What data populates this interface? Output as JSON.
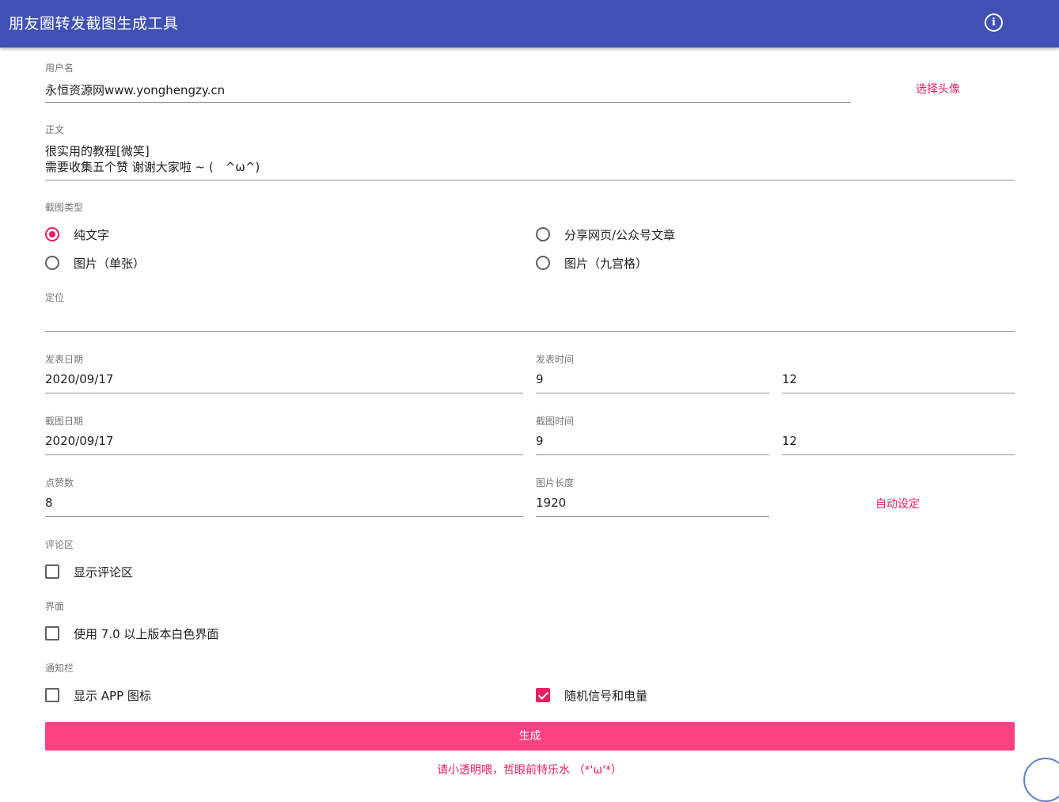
{
  "appbar": {
    "title": "朋友圈转发截图生成工具",
    "info_icon": "info-icon"
  },
  "username": {
    "label": "用户名",
    "value": "永恒资源网www.yonghengzy.cn",
    "choose_avatar": "选择头像"
  },
  "body": {
    "label": "正文",
    "line1": "很实用的教程[微笑]",
    "line2": "需要收集五个赞 谢谢大家啦 ~ (　^ω^)"
  },
  "screenshot_type": {
    "label": "截图类型",
    "options": [
      {
        "label": "纯文字",
        "selected": true
      },
      {
        "label": "分享网页/公众号文章",
        "selected": false
      },
      {
        "label": "图片（单张）",
        "selected": false
      },
      {
        "label": "图片（九宫格）",
        "selected": false
      }
    ]
  },
  "location": {
    "label": "定位",
    "value": ""
  },
  "post_date": {
    "label": "发表日期",
    "value": "2020/09/17"
  },
  "post_time": {
    "label": "发表时间",
    "hour": "9",
    "minute": "12"
  },
  "shot_date": {
    "label": "截图日期",
    "value": "2020/09/17"
  },
  "shot_time": {
    "label": "截图时间",
    "hour": "9",
    "minute": "12"
  },
  "likes": {
    "label": "点赞数",
    "value": "8"
  },
  "image_length": {
    "label": "图片长度",
    "value": "1920",
    "auto_set": "自动设定"
  },
  "comments": {
    "label": "评论区",
    "option": "显示评论区",
    "checked": false
  },
  "ui": {
    "label": "界面",
    "option": "使用 7.0 以上版本白色界面",
    "checked": false
  },
  "notification": {
    "label": "通知栏",
    "app_icon": "显示 APP 图标",
    "app_icon_checked": false,
    "random_signal": "随机信号和电量",
    "random_signal_checked": true
  },
  "generate_button": "生成",
  "footer": "请小透明喂，哲眼前特乐水 （*'ω'*）",
  "colors": {
    "primary": "#3f51b5",
    "accent": "#e91e63",
    "button": "#ff4081"
  }
}
